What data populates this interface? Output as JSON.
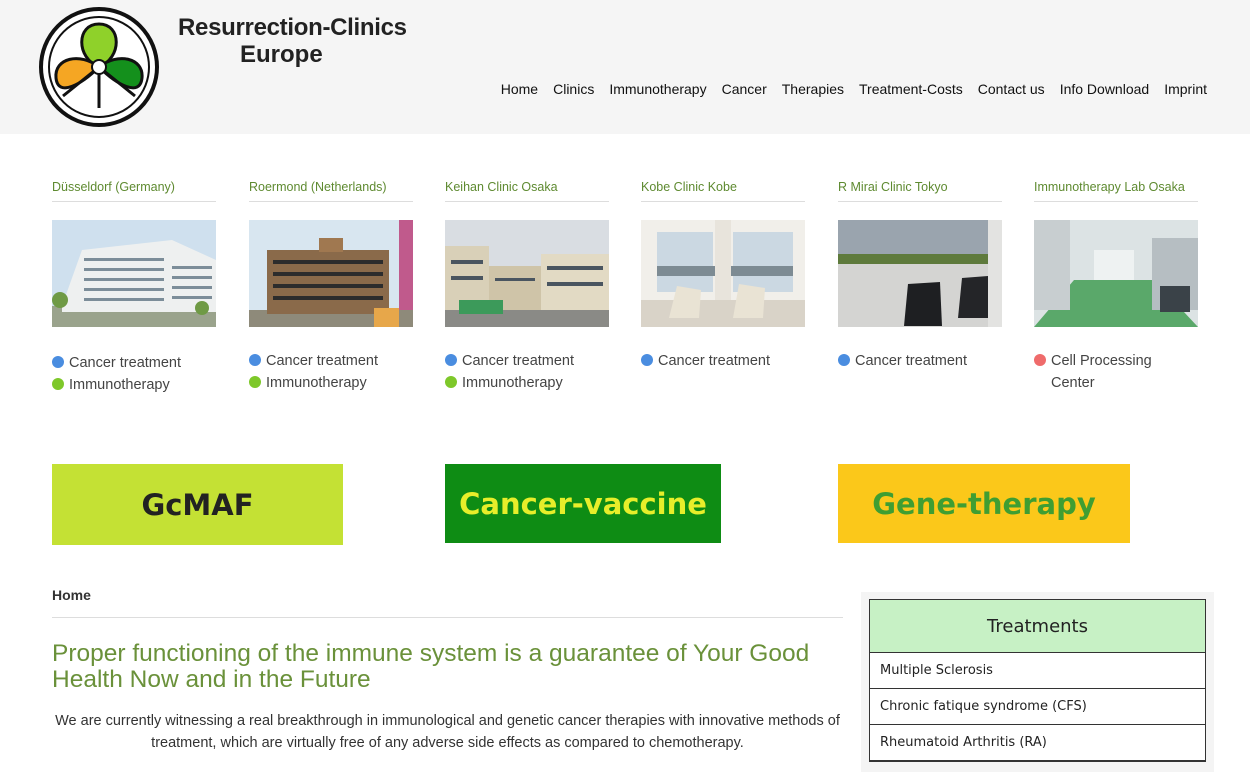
{
  "header": {
    "brand_line1": "Resurrection-Clinics",
    "brand_line2": "Europe",
    "nav": [
      "Home",
      "Clinics",
      "Immunotherapy",
      "Cancer",
      "Therapies",
      "Treatment-Costs",
      "Contact us",
      "Info Download",
      "Imprint"
    ]
  },
  "clinics": [
    {
      "name": "Düsseldorf (Germany)",
      "tags": [
        {
          "label": "Cancer treatment",
          "color": "#4a8de0"
        },
        {
          "label": "Immunotherapy",
          "color": "#7ec82a"
        }
      ]
    },
    {
      "name": "Roermond (Netherlands)",
      "tags": [
        {
          "label": "Cancer treatment",
          "color": "#4a8de0"
        },
        {
          "label": "Immunotherapy",
          "color": "#7ec82a"
        }
      ]
    },
    {
      "name": "Keihan Clinic Osaka",
      "tags": [
        {
          "label": "Cancer treatment",
          "color": "#4a8de0"
        },
        {
          "label": "Immunotherapy",
          "color": "#7ec82a"
        }
      ]
    },
    {
      "name": "Kobe Clinic Kobe",
      "tags": [
        {
          "label": "Cancer treatment",
          "color": "#4a8de0"
        }
      ]
    },
    {
      "name": "R Mirai Clinic Tokyo",
      "tags": [
        {
          "label": "Cancer treatment",
          "color": "#4a8de0"
        }
      ]
    },
    {
      "name": "Immunotherapy Lab Osaka",
      "tags": [
        {
          "label": "Cell Processing Center",
          "color": "#ef6b6b"
        }
      ]
    }
  ],
  "banners": {
    "gcmaf": "GcMAF",
    "vaccine": "Cancer-vaccine",
    "gene": "Gene-therapy"
  },
  "main": {
    "breadcrumb": "Home",
    "headline": "Proper functioning of the immune system is a guarantee of Your Good Health Now and in the Future",
    "intro": "We are currently witnessing a real breakthrough in immunological and genetic cancer therapies with innovative methods of treatment, which are virtually free of any adverse side effects as compared to chemotherapy."
  },
  "sidebar": {
    "title": "Treatments",
    "items": [
      "Multiple Sclerosis",
      "Chronic fatique syndrome (CFS)",
      "Rheumatoid Arthritis (RA)"
    ]
  },
  "colors": {
    "clinic_title": "#5e8a30",
    "headline": "#6a913a",
    "treatments_header": "#c7f1c5"
  }
}
